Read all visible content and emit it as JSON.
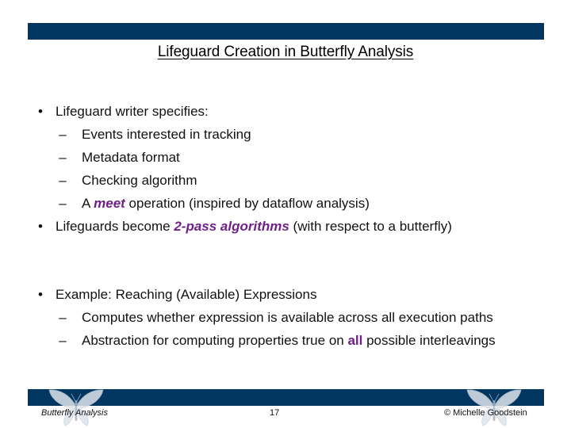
{
  "slide": {
    "title": "Lifeguard Creation in Butterfly Analysis",
    "colors": {
      "bar": "#003660",
      "accent": "#70208a"
    },
    "bullets": [
      {
        "text": "Lifeguard writer specifies:",
        "sub": [
          {
            "text": "Events interested in tracking"
          },
          {
            "text": "Metadata format"
          },
          {
            "text": "Checking algorithm"
          },
          {
            "pre": "A ",
            "emph": "meet",
            "post": " operation  (inspired by dataflow analysis)"
          }
        ]
      },
      {
        "pre": "Lifeguards become ",
        "emph": "2-pass algorithms",
        "post": " (with respect to a butterfly)"
      },
      {
        "text": "Example:  Reaching (Available) Expressions",
        "sub": [
          {
            "text": "Computes whether expression is available across all execution paths"
          },
          {
            "pre": "Abstraction for computing properties true on ",
            "emph": "all",
            "post": " possible interleavings"
          }
        ]
      }
    ],
    "bullet_glyph": "•",
    "dash_glyph": "–"
  },
  "footer": {
    "left": "Butterfly Analysis",
    "page_number": "17",
    "right": "© Michelle Goodstein",
    "icons": [
      "butterfly-icon",
      "butterfly-icon"
    ]
  }
}
